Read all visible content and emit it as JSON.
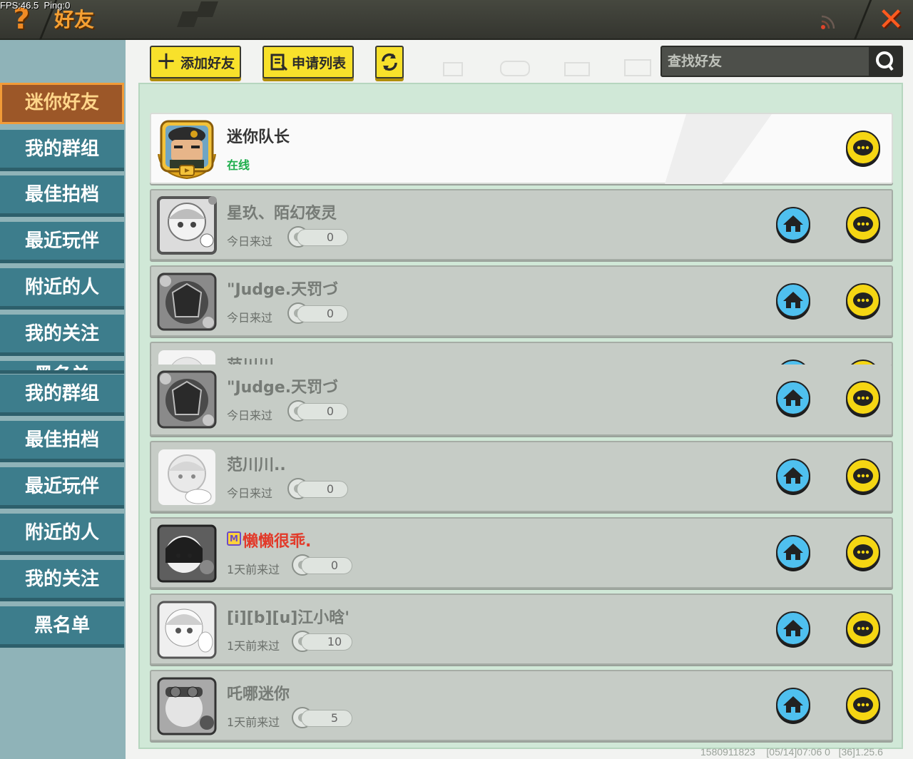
{
  "debug": {
    "fps": "FPS:46.5",
    "ping": "Ping:0"
  },
  "window": {
    "title": "好友",
    "help_icon": "question-icon",
    "close_icon": "close-icon"
  },
  "colors": {
    "accent_orange": "#f5a033",
    "button_yellow": "#f8e12b",
    "online_green": "#1eae4c",
    "sidebar_teal": "#3d7d8c",
    "vip_red": "#e23a2a"
  },
  "toolbar": {
    "add_friend": "添加好友",
    "request_list": "申请列表",
    "refresh_icon": "refresh-icon",
    "search_placeholder": "查找好友"
  },
  "sidebar": {
    "items": [
      {
        "label": "迷你好友",
        "active": true
      },
      {
        "label": "我的群组"
      },
      {
        "label": "最佳拍档"
      },
      {
        "label": "最近玩伴"
      },
      {
        "label": "附近的人"
      },
      {
        "label": "我的关注"
      },
      {
        "label": "黑名单"
      }
    ],
    "glitch_repeat": [
      {
        "label": "我的群组"
      },
      {
        "label": "最佳拍档"
      },
      {
        "label": "最近玩伴"
      },
      {
        "label": "附近的人"
      },
      {
        "label": "我的关注"
      },
      {
        "label": "黑名单"
      }
    ]
  },
  "friends": [
    {
      "name": "迷你队长",
      "status": "在线",
      "online": true
    },
    {
      "name": "星玖、陌幻夜灵",
      "status": "今日来过",
      "count": "0"
    },
    {
      "name": "\"Judge.天罚づ",
      "status": "今日来过",
      "count": "0"
    },
    {
      "name": "范川川..",
      "status": "",
      "count": ""
    },
    {
      "name": "\"Judge.天罚づ",
      "status": "今日来过",
      "count": "0"
    },
    {
      "name": "范川川..",
      "status": "今日来过",
      "count": "0"
    },
    {
      "name": "懒懒很乖.",
      "status": "1天前来过",
      "count": "0",
      "vip": true
    },
    {
      "name": "[i][b][u]江小晗'",
      "status": "1天前来过",
      "count": "10"
    },
    {
      "name": "吒哪迷你",
      "status": "1天前来过",
      "count": "5"
    }
  ],
  "footer": {
    "uid": "1580911823",
    "build": "[05/14]07:06 0",
    "version": "[36]1.25.6"
  }
}
